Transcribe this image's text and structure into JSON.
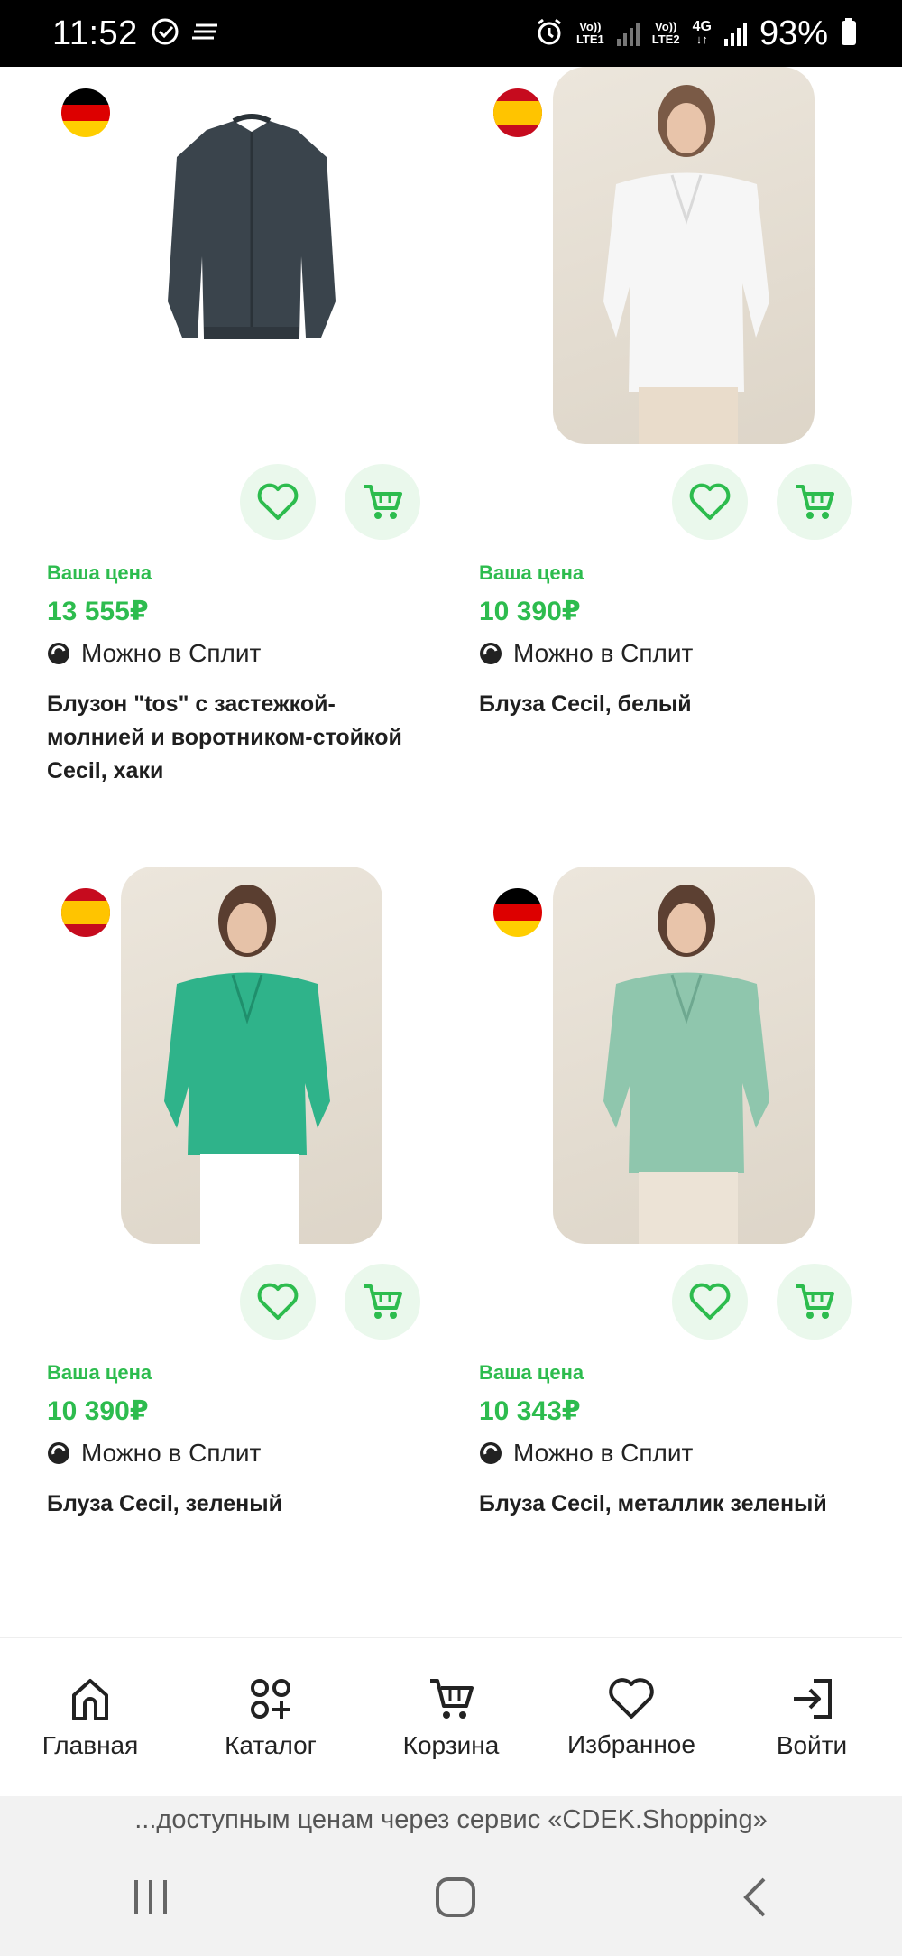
{
  "status_bar": {
    "time": "11:52",
    "battery": "93%",
    "sim1": [
      "Vo))",
      "LTE1"
    ],
    "sim2": [
      "Vo))",
      "LTE2"
    ],
    "network": "4G"
  },
  "products": [
    {
      "flag": "germany",
      "price_label": "Ваша цена",
      "price": "13 555₽",
      "split": "Можно в Сплит",
      "title": "Блузон \"tos\" с застежкой-молнией и воротником-стойкой Cecil, хаки"
    },
    {
      "flag": "spain",
      "price_label": "Ваша цена",
      "price": "10 390₽",
      "split": "Можно в Сплит",
      "title": "Блуза Cecil, белый"
    },
    {
      "flag": "spain",
      "price_label": "Ваша цена",
      "price": "10 390₽",
      "split": "Можно в Сплит",
      "title": "Блуза Cecil, зеленый"
    },
    {
      "flag": "germany",
      "price_label": "Ваша цена",
      "price": "10 343₽",
      "split": "Можно в Сплит",
      "title": "Блуза Cecil, металлик зеленый"
    }
  ],
  "bottom_nav": {
    "home": "Главная",
    "catalog": "Каталог",
    "cart": "Корзина",
    "favorites": "Избранное",
    "login": "Войти"
  },
  "banner_text": "...доступным ценам через сервис «CDEK.Shopping»",
  "colors": {
    "accent_green": "#2dbc4e",
    "button_bg": "#eaf8ec",
    "status_bar": "#000000"
  }
}
